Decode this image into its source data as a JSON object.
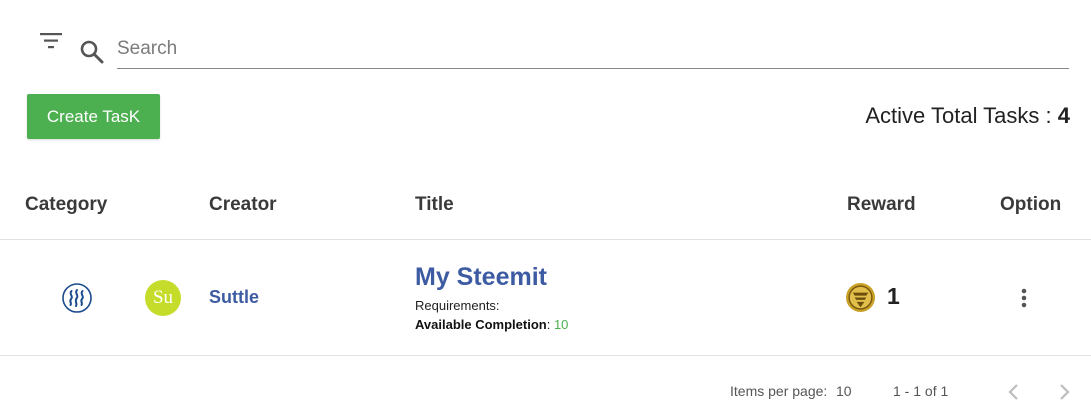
{
  "search": {
    "placeholder": "Search",
    "value": ""
  },
  "toolbar": {
    "create_label": "Create TasK",
    "active_total_label": "Active Total Tasks : ",
    "active_total_count": "4"
  },
  "table": {
    "columns": {
      "category": "Category",
      "creator": "Creator",
      "title": "Title",
      "reward": "Reward",
      "option": "Option"
    },
    "rows": [
      {
        "category_icon": "steem-icon",
        "avatar_text": "Su",
        "creator": "Suttle",
        "title": "My Steemit",
        "requirements_label": "Requirements:",
        "available_label": "Available Completion",
        "available_sep": ": ",
        "available_value": "10",
        "reward_icon": "coin-icon",
        "reward_value": "1"
      }
    ]
  },
  "paginator": {
    "items_per_page_label": "Items per page:",
    "page_size": "10",
    "range_label": "1 - 1 of 1"
  },
  "colors": {
    "accent_green": "#4caf50",
    "link_blue": "#3d5ba3",
    "avatar_bg": "#c6dc2a",
    "coin_gold": "#c9a227"
  }
}
